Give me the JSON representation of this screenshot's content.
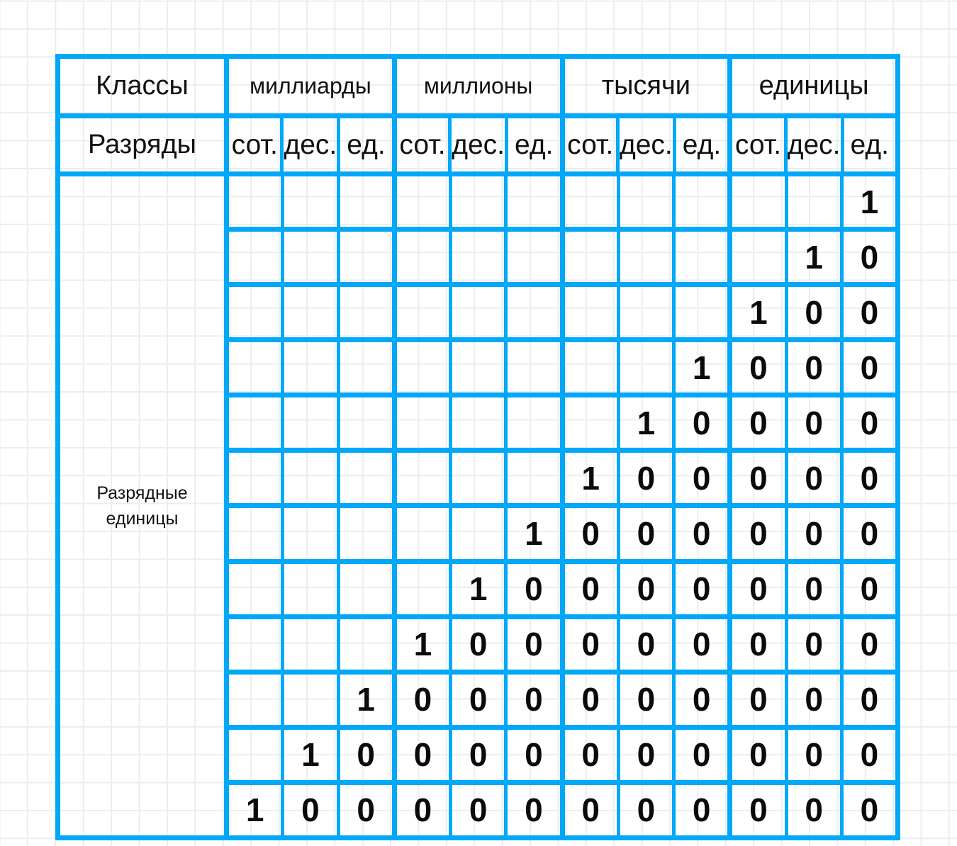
{
  "theme": {
    "border_color": "#00a8fa",
    "text_color": "#111111",
    "paper_grid_color": "#eceded",
    "background": "#ffffff"
  },
  "table": {
    "row_header_labels": {
      "classes": "Классы",
      "ranks": "Разряды",
      "units": "Разрядные единицы"
    },
    "classes": [
      {
        "name": "миллиарды"
      },
      {
        "name": "миллионы"
      },
      {
        "name": "тысячи"
      },
      {
        "name": "единицы"
      }
    ],
    "ranks": [
      [
        "сот.",
        "дес.",
        "ед."
      ],
      [
        "сот.",
        "дес.",
        "ед."
      ],
      [
        "сот.",
        "дес.",
        "ед."
      ],
      [
        "сот.",
        "дес.",
        "ед."
      ]
    ],
    "rows": [
      [
        "",
        "",
        "",
        "",
        "",
        "",
        "",
        "",
        "",
        "",
        "",
        "1"
      ],
      [
        "",
        "",
        "",
        "",
        "",
        "",
        "",
        "",
        "",
        "",
        "1",
        "0"
      ],
      [
        "",
        "",
        "",
        "",
        "",
        "",
        "",
        "",
        "",
        "1",
        "0",
        "0"
      ],
      [
        "",
        "",
        "",
        "",
        "",
        "",
        "",
        "",
        "1",
        "0",
        "0",
        "0"
      ],
      [
        "",
        "",
        "",
        "",
        "",
        "",
        "",
        "1",
        "0",
        "0",
        "0",
        "0"
      ],
      [
        "",
        "",
        "",
        "",
        "",
        "",
        "1",
        "0",
        "0",
        "0",
        "0",
        "0"
      ],
      [
        "",
        "",
        "",
        "",
        "",
        "1",
        "0",
        "0",
        "0",
        "0",
        "0",
        "0"
      ],
      [
        "",
        "",
        "",
        "",
        "1",
        "0",
        "0",
        "0",
        "0",
        "0",
        "0",
        "0"
      ],
      [
        "",
        "",
        "",
        "1",
        "0",
        "0",
        "0",
        "0",
        "0",
        "0",
        "0",
        "0"
      ],
      [
        "",
        "",
        "1",
        "0",
        "0",
        "0",
        "0",
        "0",
        "0",
        "0",
        "0",
        "0"
      ],
      [
        "",
        "1",
        "0",
        "0",
        "0",
        "0",
        "0",
        "0",
        "0",
        "0",
        "0",
        "0"
      ],
      [
        "1",
        "0",
        "0",
        "0",
        "0",
        "0",
        "0",
        "0",
        "0",
        "0",
        "0",
        "0"
      ]
    ]
  }
}
